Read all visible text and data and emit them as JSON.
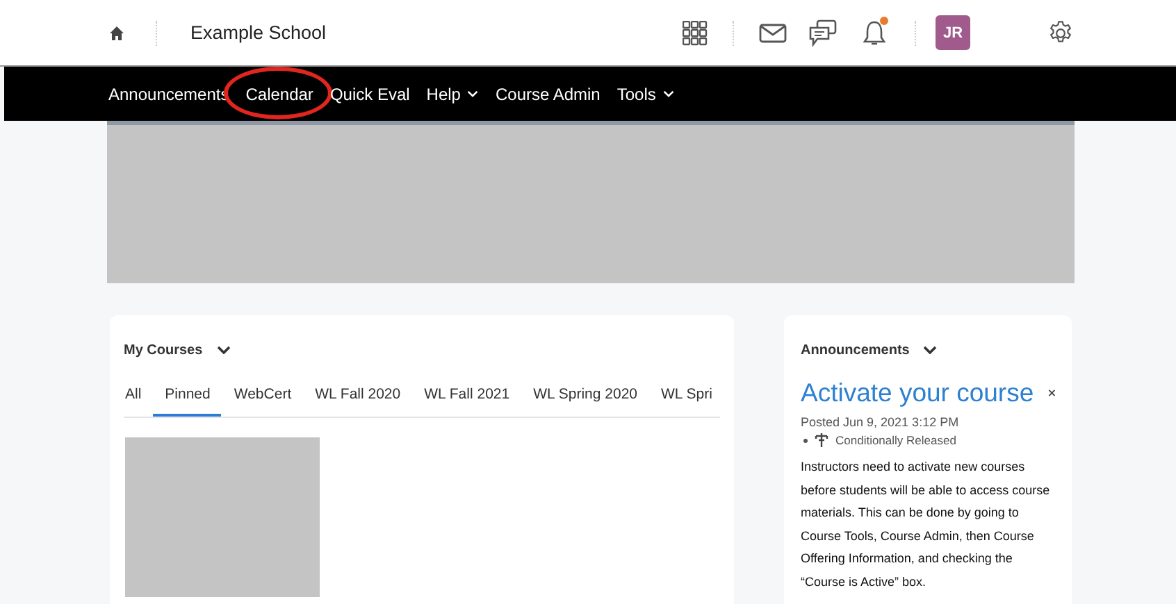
{
  "header": {
    "title": "Example School",
    "avatar": "JR",
    "notification_dot": true
  },
  "nav": [
    {
      "label": "Announcements",
      "dropdown": false,
      "circled": false
    },
    {
      "label": "Calendar",
      "dropdown": false,
      "circled": true
    },
    {
      "label": "Quick Eval",
      "dropdown": false,
      "circled": false
    },
    {
      "label": "Help",
      "dropdown": true,
      "circled": false
    },
    {
      "label": "Course Admin",
      "dropdown": false,
      "circled": false
    },
    {
      "label": "Tools",
      "dropdown": true,
      "circled": false
    }
  ],
  "my_courses": {
    "title": "My Courses",
    "tabs": [
      {
        "label": "All",
        "selected": false
      },
      {
        "label": "Pinned",
        "selected": true
      },
      {
        "label": "WebCert",
        "selected": false
      },
      {
        "label": "WL Fall 2020",
        "selected": false
      },
      {
        "label": "WL Fall 2021",
        "selected": false
      },
      {
        "label": "WL Spring 2020",
        "selected": false
      },
      {
        "label": "WL Spri",
        "selected": false
      }
    ]
  },
  "announcements": {
    "title": "Announcements",
    "item_title": "Activate your course",
    "posted": "Posted Jun 9, 2021 3:12 PM",
    "release": "Conditionally Released",
    "body": "Instructors need to activate new courses before students will be able to access course materials.  This can be done by going to Course Tools, Course Admin, then Course Offering Information, and checking the “Course is Active” box."
  }
}
